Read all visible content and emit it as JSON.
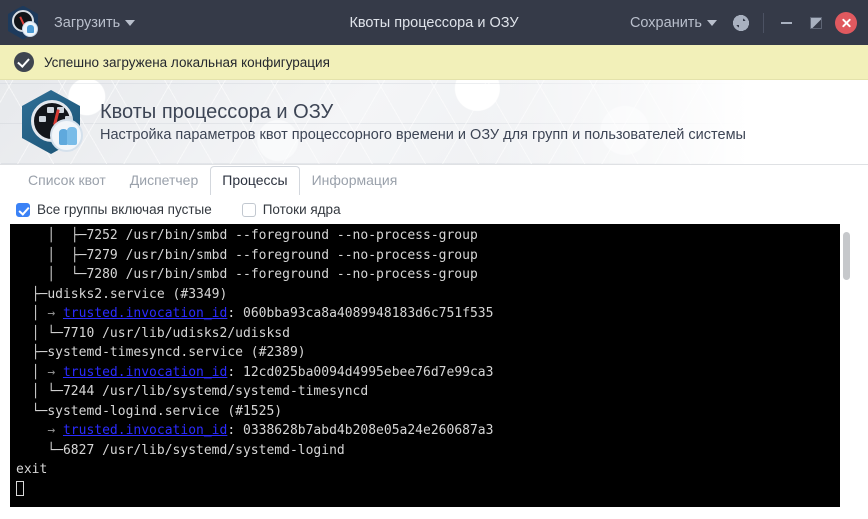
{
  "titlebar": {
    "logo_icon": "app-gauge-person-icon",
    "load_label": "Загрузить",
    "title": "Квоты процессора и ОЗУ",
    "save_label": "Сохранить",
    "settings_icon": "gear-icon",
    "minimize_icon": "minimize-icon",
    "maximize_icon": "maximize-restore-icon",
    "close_icon": "close-icon",
    "bg_color": "#353a48"
  },
  "notification": {
    "icon": "success-check-icon",
    "text": "Успешно загружена локальная конфигурация",
    "bg_color": "#f2f0b9"
  },
  "page_header": {
    "logo_icon": "gauge-person-hexagon-icon",
    "title": "Квоты процессора и ОЗУ",
    "subtitle": "Настройка параметров квот процессорного времени и ОЗУ для групп и пользователей системы"
  },
  "tabs": [
    {
      "label": "Список квот",
      "active": false
    },
    {
      "label": "Диспетчер",
      "active": false
    },
    {
      "label": "Процессы",
      "active": true
    },
    {
      "label": "Информация",
      "active": false
    }
  ],
  "options": [
    {
      "label": "Все группы включая пустые",
      "checked": true
    },
    {
      "label": "Потоки ядра",
      "checked": false
    }
  ],
  "terminal": {
    "accent_link_color": "#2b2bff",
    "bg_color": "#000000",
    "fg_color": "#d6d6d6",
    "lines": [
      {
        "tree": "    │  ├─",
        "text": "7252 /usr/bin/smbd --foreground --no-process-group"
      },
      {
        "tree": "    │  ├─",
        "text": "7279 /usr/bin/smbd --foreground --no-process-group"
      },
      {
        "tree": "    │  └─",
        "text": "7280 /usr/bin/smbd --foreground --no-process-group"
      },
      {
        "tree": "  ├─",
        "text": "udisks2.service (#3349)"
      },
      {
        "tree": "  │ ",
        "arrow": "→ ",
        "link": "trusted.invocation_id",
        "text": ": 060bba93ca8a4089948183d6c751f535"
      },
      {
        "tree": "  │ └─",
        "text": "7710 /usr/lib/udisks2/udisksd"
      },
      {
        "tree": "  ├─",
        "text": "systemd-timesyncd.service (#2389)"
      },
      {
        "tree": "  │ ",
        "arrow": "→ ",
        "link": "trusted.invocation_id",
        "text": ": 12cd025ba0094d4995ebee76d7e99ca3"
      },
      {
        "tree": "  │ └─",
        "text": "7244 /usr/lib/systemd/systemd-timesyncd"
      },
      {
        "tree": "  └─",
        "text": "systemd-logind.service (#1525)"
      },
      {
        "tree": "    ",
        "arrow": "→ ",
        "link": "trusted.invocation_id",
        "text": ": 0338628b7abd4b208e05a24e260687a3"
      },
      {
        "tree": "    └─",
        "text": "6827 /usr/lib/systemd/systemd-logind"
      },
      {
        "tree": "",
        "text": "exit"
      }
    ],
    "cursor_visible": true
  }
}
